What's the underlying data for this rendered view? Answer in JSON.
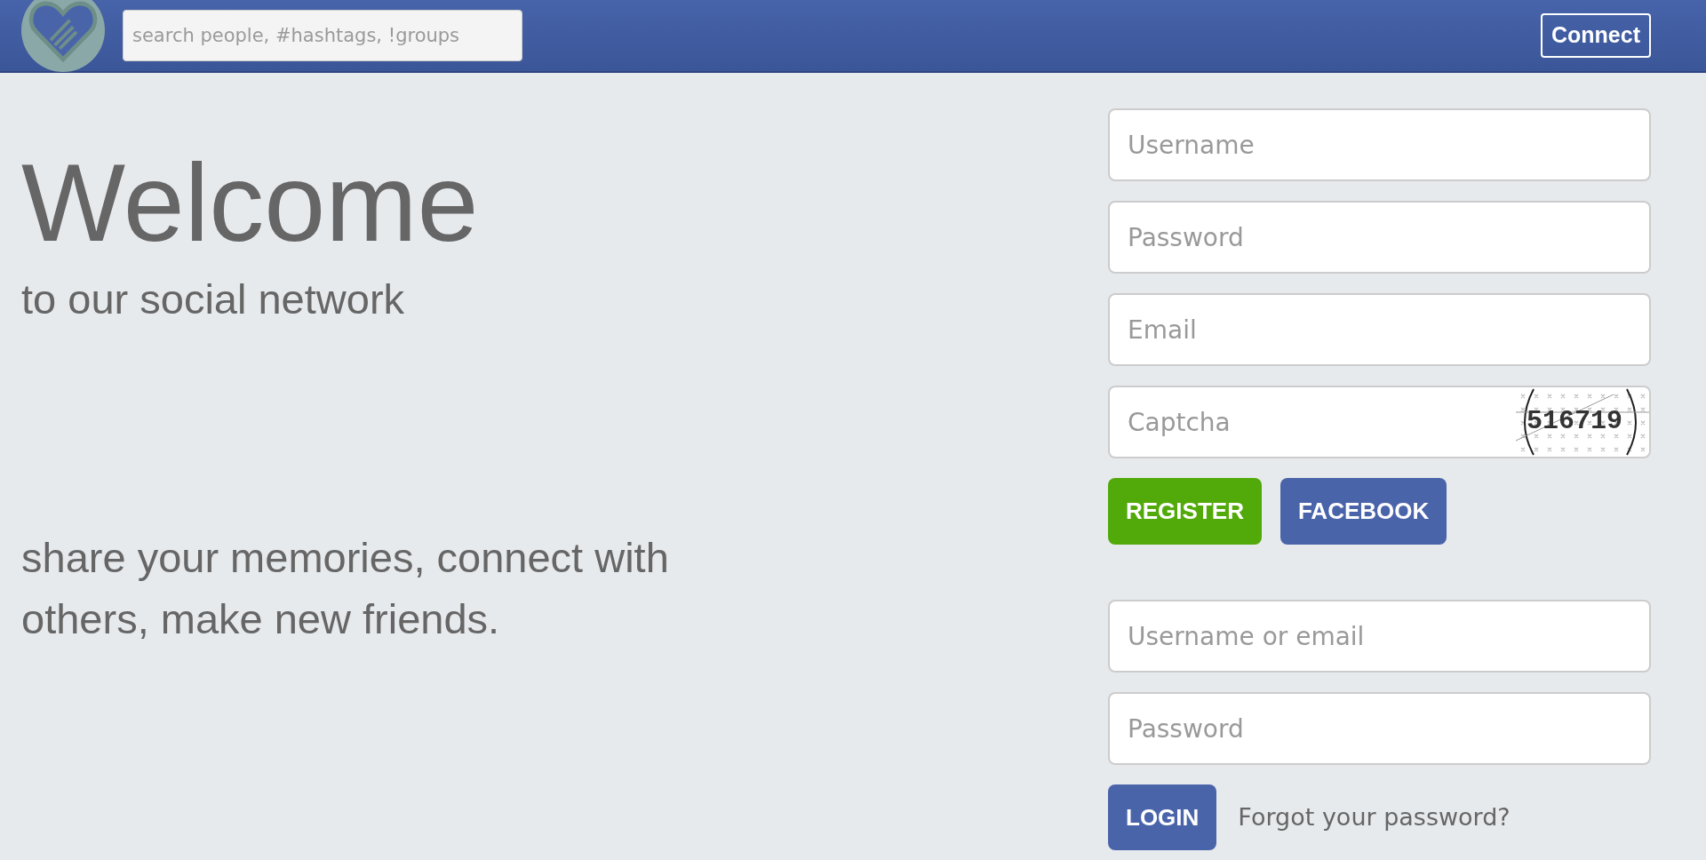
{
  "header": {
    "search": {
      "placeholder": "search people, #hashtags, !groups"
    },
    "connect_button": "Connect"
  },
  "hero": {
    "title": "Welcome",
    "subtitle": "to our social network",
    "tagline": "share your memories, connect with others, make new friends."
  },
  "register_form": {
    "fields": [
      {
        "placeholder": "Username",
        "kind": "text"
      },
      {
        "placeholder": "Password",
        "kind": "text"
      },
      {
        "placeholder": "Email",
        "kind": "text"
      },
      {
        "placeholder": "Captcha",
        "kind": "captcha",
        "captcha_code": "516719"
      }
    ],
    "buttons": [
      {
        "label": "REGISTER",
        "kind": "register"
      },
      {
        "label": "FACEBOOK",
        "kind": "facebook"
      }
    ]
  },
  "login_form": {
    "fields": [
      {
        "placeholder": "Username or email"
      },
      {
        "placeholder": "Password"
      }
    ],
    "button": "LOGIN",
    "forgot_link": "Forgot your password?"
  }
}
